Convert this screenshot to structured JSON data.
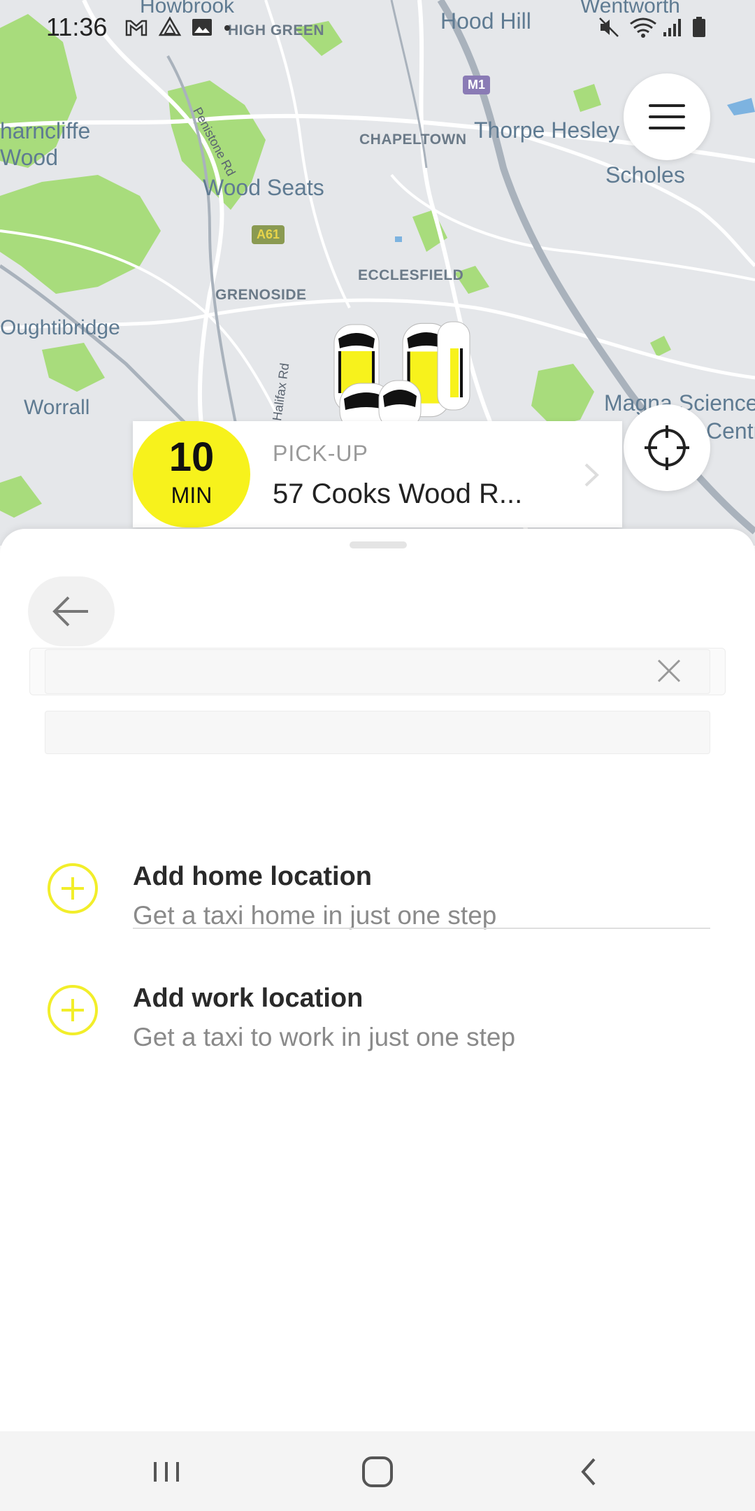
{
  "status_bar": {
    "time": "11:36",
    "icons": [
      "gmail-icon",
      "drive-icon",
      "gallery-icon",
      "notification-dot-icon",
      "mute-icon",
      "wifi-icon",
      "signal-icon",
      "battery-icon"
    ]
  },
  "map": {
    "labels": {
      "harncliffe_wood": "harncliffe\nWood",
      "hood_hill": "Hood Hill",
      "high_green": "HIGH GREEN",
      "penistone_rd": "Penistone Rd",
      "chapeltown": "CHAPELTOWN",
      "thorpe_hesley": "Thorpe Hesley",
      "scholes": "Scholes",
      "wood_seats": "Wood Seats",
      "ecclesfield": "ECCLESFIELD",
      "grenoside": "GRENOSIDE",
      "oughtibridge": "Oughtibridge",
      "worrall": "Worrall",
      "halifax_rd": "Halifax Rd",
      "magna_science": "Magna Science",
      "centre": "Centr",
      "howbrook": "Howbrook",
      "wentworth": "Wentworth"
    },
    "shields": {
      "m1": "M1",
      "a61": "A61"
    }
  },
  "pickup": {
    "eta_value": "10",
    "eta_unit": "MIN",
    "label": "PICK-UP",
    "address": "57 Cooks Wood R..."
  },
  "search": {
    "pickup_value": "",
    "destination_value": ""
  },
  "saved_locations": {
    "home": {
      "title": "Add home location",
      "subtitle": "Get a taxi home in just one step"
    },
    "work": {
      "title": "Add work location",
      "subtitle": "Get a taxi to work in just one step"
    }
  },
  "colors": {
    "accent": "#f7f21c",
    "map_green": "#a8dc7c",
    "map_background": "#e5e7ea"
  }
}
